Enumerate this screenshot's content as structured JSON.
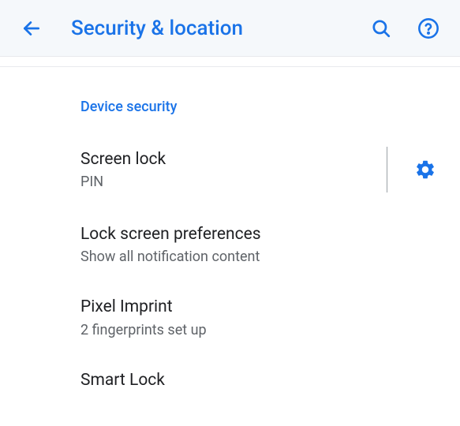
{
  "header": {
    "title": "Security & location"
  },
  "section": {
    "header": "Device security"
  },
  "settings": [
    {
      "title": "Screen lock",
      "subtitle": "PIN"
    },
    {
      "title": "Lock screen preferences",
      "subtitle": "Show all notification content"
    },
    {
      "title": "Pixel Imprint",
      "subtitle": "2 fingerprints set up"
    },
    {
      "title": "Smart Lock",
      "subtitle": ""
    }
  ],
  "colors": {
    "accent": "#1a73e8",
    "text_primary": "#202124",
    "text_secondary": "#5f6368"
  }
}
